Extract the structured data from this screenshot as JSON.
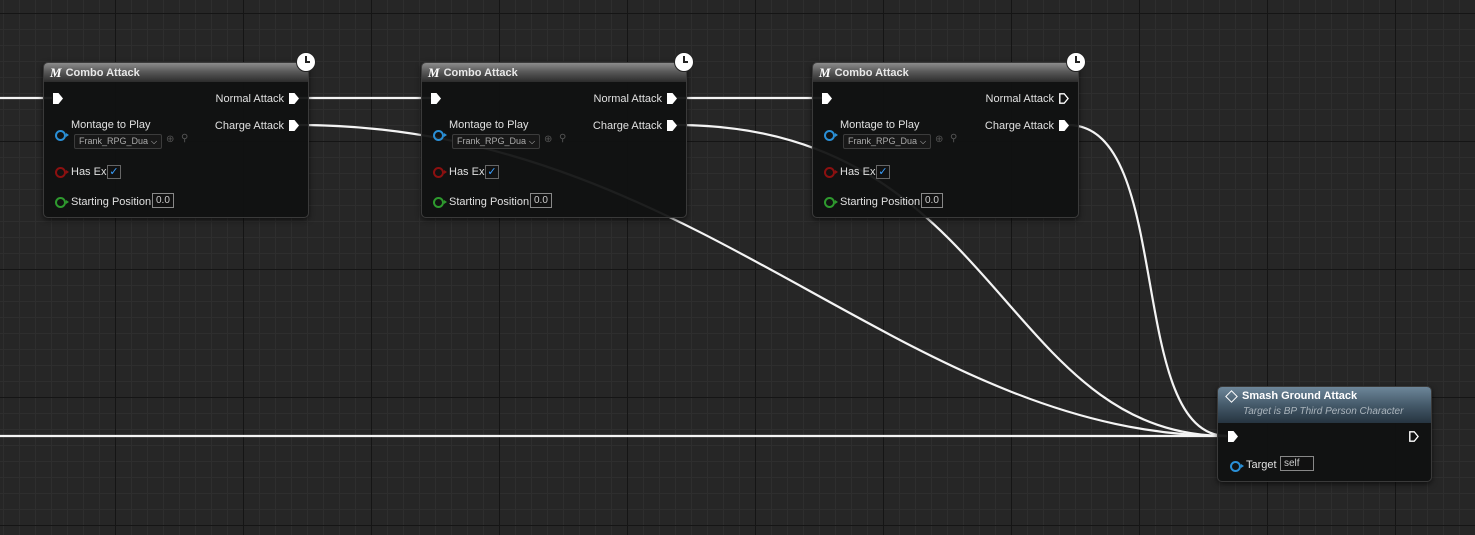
{
  "nodes": [
    {
      "title": "Combo Attack",
      "icon": "montage-icon",
      "out_normal": "Normal Attack",
      "out_charge": "Charge Attack",
      "montage_label": "Montage to Play",
      "montage_value": "Frank_RPG_Dua",
      "has_ex_label": "Has Ex",
      "has_ex_checked": "✓",
      "starting_label": "Starting Position",
      "starting_value": "0.0"
    },
    {
      "title": "Combo Attack",
      "icon": "montage-icon",
      "out_normal": "Normal Attack",
      "out_charge": "Charge Attack",
      "montage_label": "Montage to Play",
      "montage_value": "Frank_RPG_Dua",
      "has_ex_label": "Has Ex",
      "has_ex_checked": "✓",
      "starting_label": "Starting Position",
      "starting_value": "0.0"
    },
    {
      "title": "Combo Attack",
      "icon": "montage-icon",
      "out_normal": "Normal Attack",
      "out_charge": "Charge Attack",
      "montage_label": "Montage to Play",
      "montage_value": "Frank_RPG_Dua",
      "has_ex_label": "Has Ex",
      "has_ex_checked": "✓",
      "starting_label": "Starting Position",
      "starting_value": "0.0"
    }
  ],
  "smash": {
    "title": "Smash Ground Attack",
    "subtitle": "Target is BP Third Person Character",
    "target_label": "Target",
    "target_value": "self"
  },
  "colors": {
    "exec_wire": "#ffffff",
    "object_pin": "#2a8fd6",
    "bool_pin": "#8c1010",
    "float_pin": "#2e9a2e",
    "function_header": "#455a6a"
  }
}
